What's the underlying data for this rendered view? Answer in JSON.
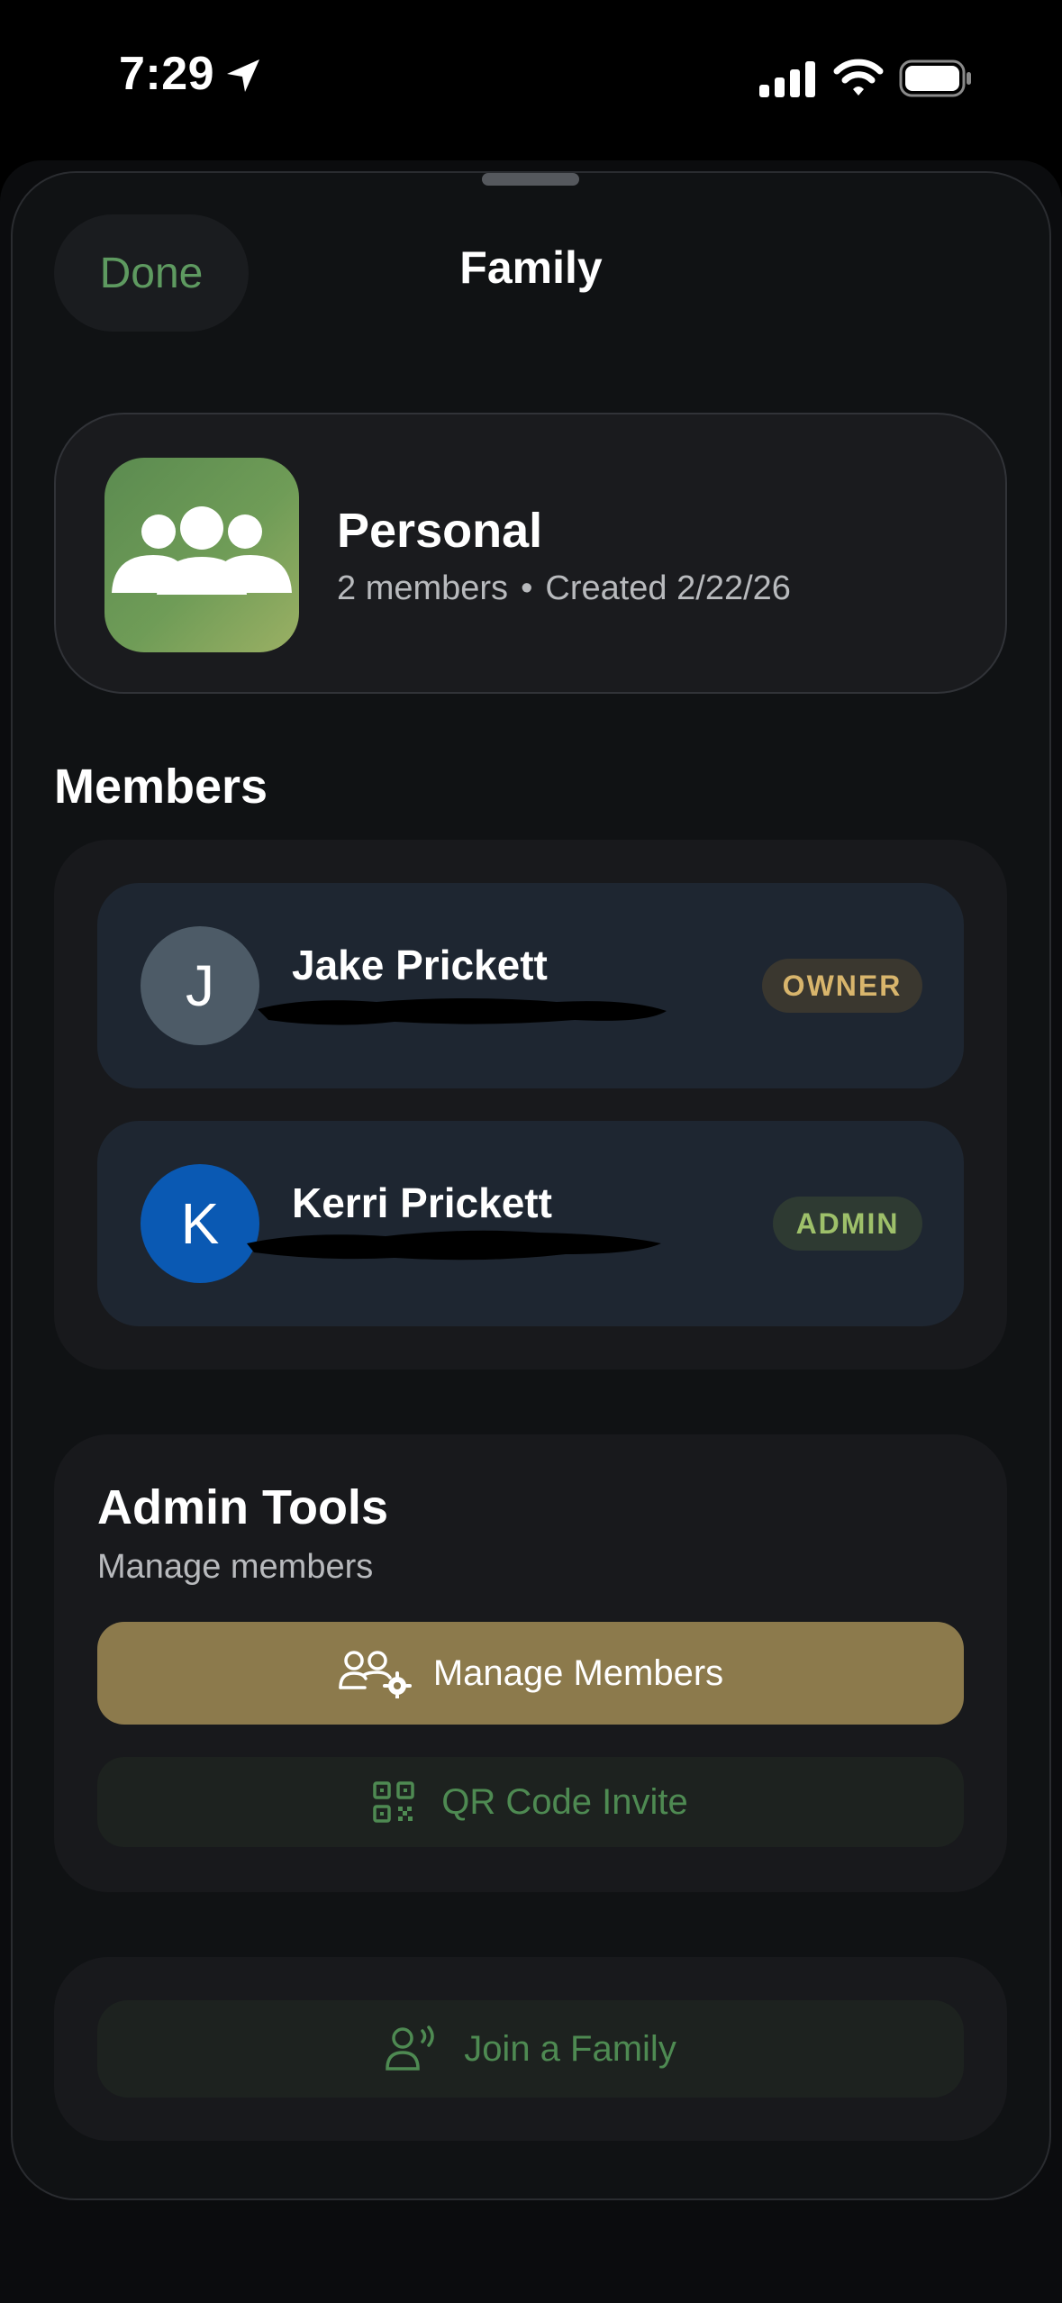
{
  "status_bar": {
    "time": "7:29"
  },
  "header": {
    "done_label": "Done",
    "title": "Family"
  },
  "family": {
    "name": "Personal",
    "members_count": "2 members",
    "separator": "•",
    "created": "Created 2/22/26",
    "icon": "people-group-icon"
  },
  "members_section": {
    "title": "Members",
    "members": [
      {
        "initial": "J",
        "name": "Jake Prickett",
        "role": "OWNER"
      },
      {
        "initial": "K",
        "name": "Kerri Prickett",
        "role": "ADMIN"
      }
    ]
  },
  "admin_tools": {
    "title": "Admin Tools",
    "subtitle": "Manage members",
    "manage_label": "Manage Members",
    "qr_label": "QR Code Invite"
  },
  "join": {
    "label": "Join a Family"
  },
  "colors": {
    "accent_green": "#5e9a60",
    "manage_button": "#8c7a4c",
    "owner_badge_text": "#d8b56c",
    "admin_badge_text": "#9ec06a"
  }
}
